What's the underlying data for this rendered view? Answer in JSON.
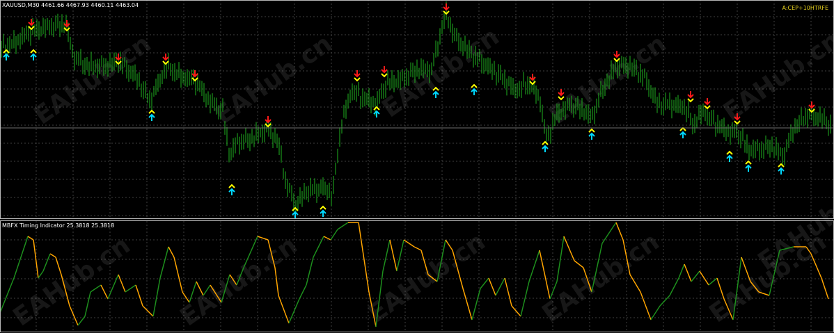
{
  "main_chart": {
    "symbol_title": "XAUUSD,M30",
    "ohlc_text": "4461.66 4467.93 4460.11 4463.04",
    "corner_label": "A:CEP+10HTRFE",
    "candle_color": "#1fb31f",
    "background_color": "#000000",
    "grid_color": "#404040",
    "up_arrow_color": "#00d8ff",
    "up_arrow_tail_color": "#ffff00",
    "down_arrow_color": "#ff1a1a",
    "down_arrow_tail_color": "#ffff00"
  },
  "indicator": {
    "title": "MBFX Timing Indicator 25.3818 25.3818",
    "rising_color": "#1d8f1d",
    "falling_color": "#ffa500"
  },
  "watermark": {
    "text": "EAHub.cn",
    "main_positions_count": 5,
    "indicator_positions_count": 6
  },
  "icons": [
    "up-arrow-icon",
    "down-arrow-icon"
  ]
}
